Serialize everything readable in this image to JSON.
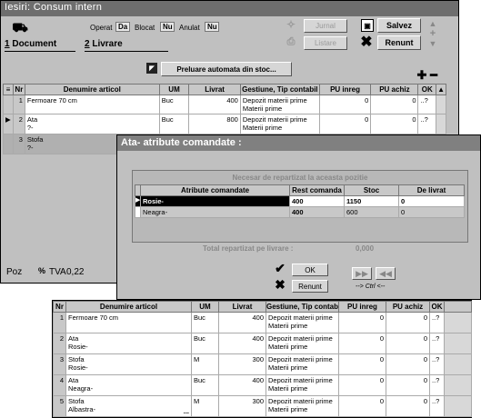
{
  "window": {
    "title": "Iesiri: Consum intern"
  },
  "flags": [
    {
      "label": "Operat",
      "value": "Da"
    },
    {
      "label": "Blocat",
      "value": "Nu"
    },
    {
      "label": "Anulat",
      "value": "Nu"
    }
  ],
  "buttons": {
    "jurnal": "Jurnal",
    "listare": "Listare",
    "salvez": "Salvez",
    "renunt": "Renunt",
    "preluare": "Preluare automata din stoc..."
  },
  "tabs": [
    {
      "key": "1",
      "label": "Document"
    },
    {
      "key": "2",
      "label": "Livrare"
    }
  ],
  "grid": {
    "headers": [
      "Nr",
      "Denumire articol",
      "UM",
      "Livrat",
      "Gestiune, Tip contabil",
      "PU inreg",
      "PU achiz",
      "OK"
    ],
    "rows": [
      {
        "nr": "1",
        "name": "Fermoare 70 cm",
        "sub": "",
        "um": "Buc",
        "qty": "400",
        "gest": "Depozit materii prime",
        "tip": "Materii prime",
        "pu1": "0",
        "pu2": "0",
        "ok": "..?"
      },
      {
        "nr": "2",
        "name": "Ata",
        "sub": "?-",
        "um": "Buc",
        "qty": "800",
        "gest": "Depozit materii prime",
        "tip": "Materii prime",
        "pu1": "0",
        "pu2": "0",
        "ok": "..?"
      },
      {
        "nr": "3",
        "name": "Stofa",
        "sub": "?-",
        "um": "",
        "qty": "",
        "gest": "",
        "tip": "",
        "pu1": "",
        "pu2": "",
        "ok": ""
      }
    ]
  },
  "status": {
    "poz": "Poz",
    "tva_label": "TVA",
    "tva": "0,22"
  },
  "dialog": {
    "title": "Ata- atribute comandate :",
    "heading": "Necesar de repartizat la aceasta pozitie",
    "headers": [
      "Atribute comandate",
      "Rest comanda",
      "Stoc",
      "De livrat"
    ],
    "rows": [
      {
        "attr": "Rosie-",
        "rest": "400",
        "stoc": "1150",
        "livrat": "0"
      },
      {
        "attr": "Neagra-",
        "rest": "400",
        "stoc": "600",
        "livrat": "0"
      }
    ],
    "total_label": "Total repartizat pe livrare :",
    "total": "0,000",
    "ok": "OK",
    "renunt": "Renunt",
    "ctrl": "--> Ctrl <--"
  },
  "result": {
    "headers": [
      "Nr",
      "Denumire articol",
      "UM",
      "Livrat",
      "Gestiune, Tip contabil",
      "PU inreg",
      "PU achiz",
      "OK"
    ],
    "rows": [
      {
        "nr": "1",
        "name": "Fermoare 70 cm",
        "sub": "",
        "um": "Buc",
        "qty": "400",
        "gest": "Depozit materii prime",
        "tip": "Materii prime",
        "pu1": "0",
        "pu2": "0",
        "ok": "..?"
      },
      {
        "nr": "2",
        "name": "Ata",
        "sub": "Rosie-",
        "um": "Buc",
        "qty": "400",
        "gest": "Depozit materii prime",
        "tip": "Materii prime",
        "pu1": "0",
        "pu2": "0",
        "ok": "..?"
      },
      {
        "nr": "3",
        "name": "Stofa",
        "sub": "Rosie-",
        "um": "M",
        "qty": "300",
        "gest": "Depozit materii prime",
        "tip": "Materii prime",
        "pu1": "0",
        "pu2": "0",
        "ok": "..?"
      },
      {
        "nr": "4",
        "name": "Ata",
        "sub": "Neagra-",
        "um": "Buc",
        "qty": "400",
        "gest": "Depozit materii prime",
        "tip": "Materii prime",
        "pu1": "0",
        "pu2": "0",
        "ok": "..?"
      },
      {
        "nr": "5",
        "name": "Stofa",
        "sub": "Albastra-",
        "um": "M",
        "qty": "300",
        "gest": "Depozit materii prime",
        "tip": "Materii prime",
        "pu1": "0",
        "pu2": "0",
        "ok": "..?"
      }
    ]
  }
}
